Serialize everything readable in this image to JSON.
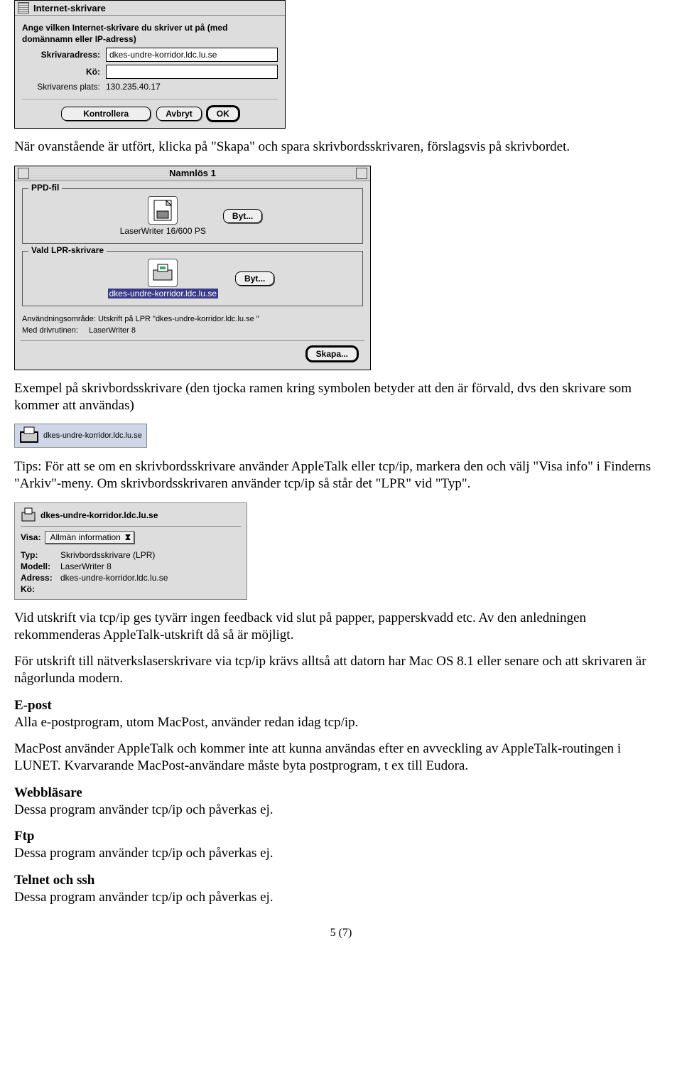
{
  "dialog1": {
    "title": "Internet-skrivare",
    "instruction": "Ange vilken Internet-skrivare du skriver ut på (med domännamn eller IP-adress)",
    "label_address": "Skrivaradress:",
    "address_value": "dkes-undre-korridor.ldc.lu.se",
    "label_queue": "Kö:",
    "queue_value": "",
    "label_location": "Skrivarens plats:",
    "location_value": "130.235.40.17",
    "btn_verify": "Kontrollera",
    "btn_cancel": "Avbryt",
    "btn_ok": "OK"
  },
  "para1": "När ovanstående är utfört, klicka på \"Skapa\" och spara skrivbordsskrivaren, förslagsvis på skrivbordet.",
  "dialog2": {
    "title": "Namnlös 1",
    "ppd_legend": "PPD-fil",
    "ppd_name": "LaserWriter 16/600 PS",
    "btn_change": "Byt...",
    "lpr_legend": "Vald LPR-skrivare",
    "lpr_name": "dkes-undre-korridor.ldc.lu.se",
    "usage_line": "Användningsområde: Utskrift på LPR  \"dkes-undre-korridor.ldc.lu.se \"",
    "driver_label": "Med drivrutinen:",
    "driver_value": "LaserWriter 8",
    "btn_create": "Skapa..."
  },
  "para2": "Exempel på skrivbordsskrivare (den tjocka ramen kring symbolen betyder att den är förvald, dvs den skrivare som kommer att användas)",
  "chip_label": "dkes-undre-korridor.ldc.lu.se",
  "para3": "Tips: För att se om en skrivbordsskrivare använder AppleTalk eller tcp/ip, markera den och välj \"Visa info\" i Finderns \"Arkiv\"-meny. Om skrivbordsskrivaren använder tcp/ip så står det \"LPR\" vid \"Typ\".",
  "info_panel": {
    "name": "dkes-undre-korridor.ldc.lu.se",
    "show_label": "Visa:",
    "show_value": "Allmän information",
    "type_k": "Typ:",
    "type_v": "Skrivbordsskrivare (LPR)",
    "model_k": "Modell:",
    "model_v": "LaserWriter 8",
    "addr_k": "Adress:",
    "addr_v": "dkes-undre-korridor.ldc.lu.se",
    "queue_k": "Kö:"
  },
  "para4": "Vid utskrift via tcp/ip ges tyvärr ingen feedback vid slut på papper, papperskvadd etc. Av den anledningen rekommenderas AppleTalk-utskrift då så är möjligt.",
  "para5": "För utskrift till nätverkslaserskrivare via tcp/ip krävs alltså att datorn har Mac OS 8.1 eller senare och att skrivaren är någorlunda modern.",
  "heading_epost": "E-post",
  "para6": "Alla e-postprogram, utom MacPost, använder redan idag tcp/ip.",
  "para7": "MacPost använder AppleTalk och kommer inte att kunna användas efter en avveckling av AppleTalk-routingen i LUNET. Kvarvarande MacPost-användare måste byta postprogram, t ex till Eudora.",
  "heading_webb": "Webbläsare",
  "para8": "Dessa program använder tcp/ip och påverkas ej.",
  "heading_ftp": "Ftp",
  "para9": "Dessa program använder tcp/ip och påverkas ej.",
  "heading_telnet": "Telnet och ssh",
  "para10": "Dessa program använder tcp/ip och påverkas ej.",
  "page_number": "5 (7)"
}
